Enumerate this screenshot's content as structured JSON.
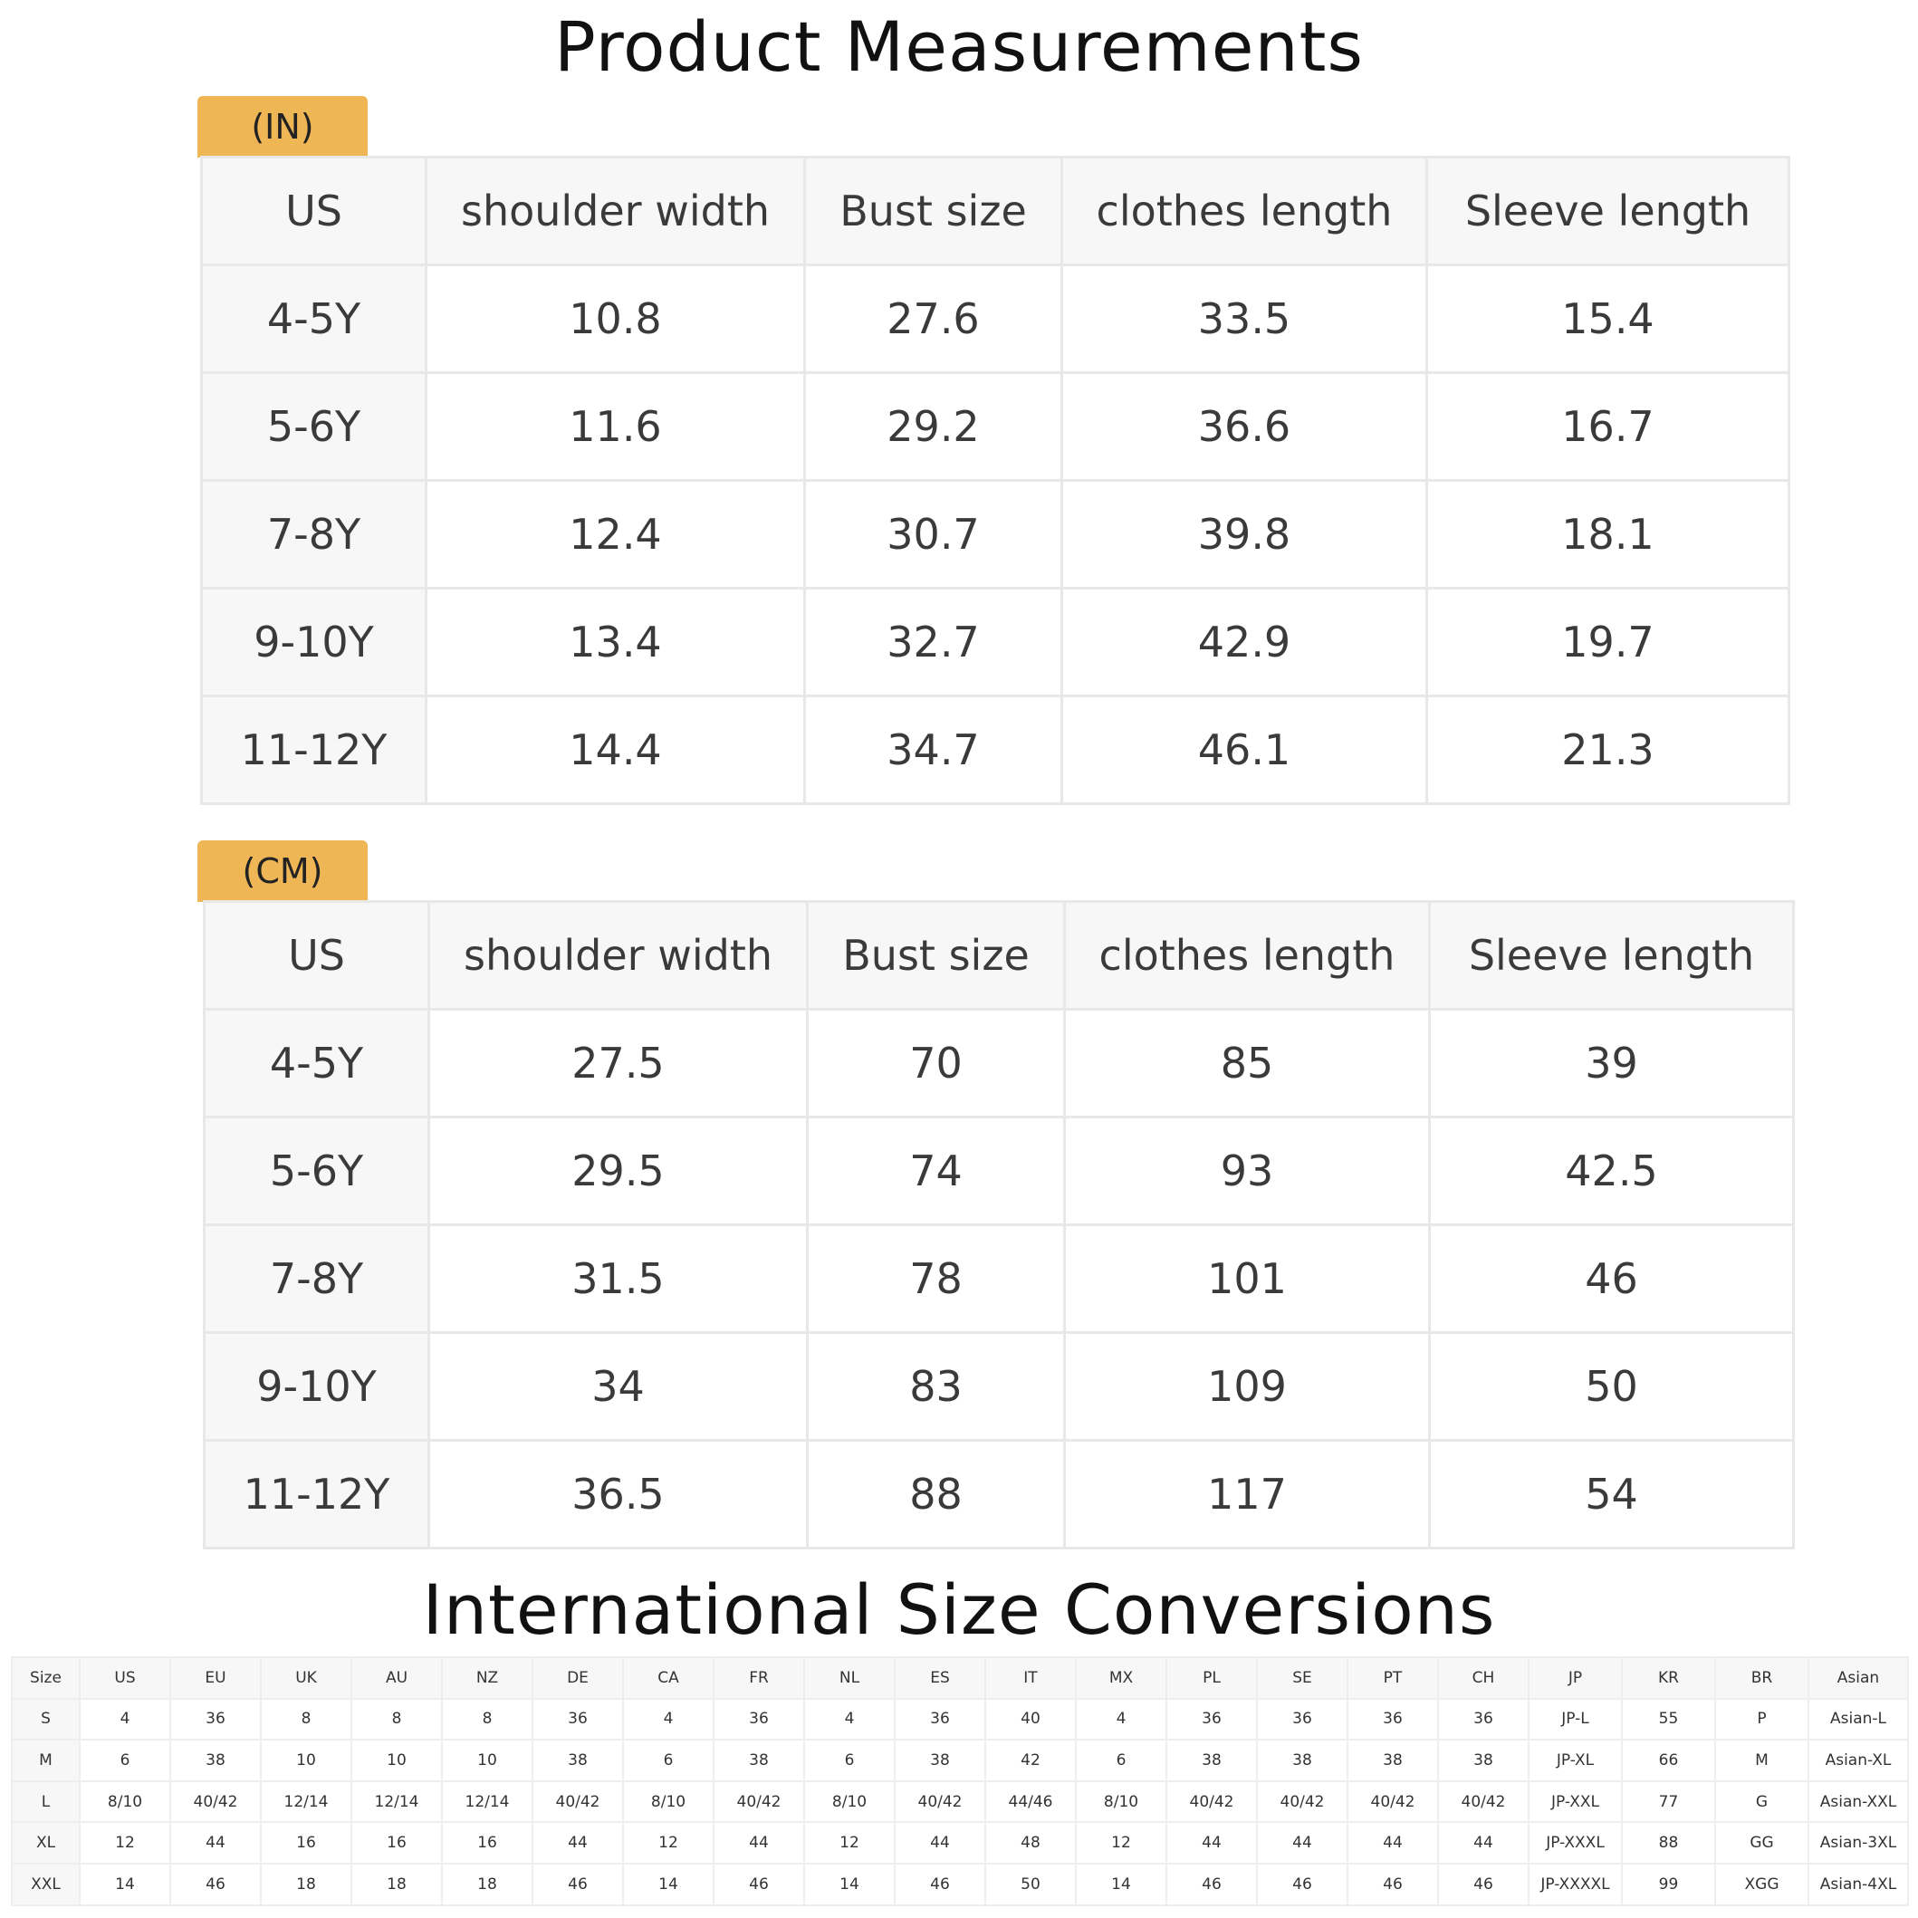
{
  "titles": {
    "product": "Product Measurements",
    "international": "International Size Conversions"
  },
  "colors": {
    "tag_background": "#efb655",
    "header_background": "#f7f7f7",
    "border": "#e8e8e8"
  },
  "inch_table": {
    "tag": "(IN)",
    "headers": [
      "US",
      "shoulder width",
      "Bust size",
      "clothes length",
      "Sleeve length"
    ],
    "rows": [
      [
        "4-5Y",
        "10.8",
        "27.6",
        "33.5",
        "15.4"
      ],
      [
        "5-6Y",
        "11.6",
        "29.2",
        "36.6",
        "16.7"
      ],
      [
        "7-8Y",
        "12.4",
        "30.7",
        "39.8",
        "18.1"
      ],
      [
        "9-10Y",
        "13.4",
        "32.7",
        "42.9",
        "19.7"
      ],
      [
        "11-12Y",
        "14.4",
        "34.7",
        "46.1",
        "21.3"
      ]
    ]
  },
  "cm_table": {
    "tag": "(CM)",
    "headers": [
      "US",
      "shoulder width",
      "Bust size",
      "clothes length",
      "Sleeve length"
    ],
    "rows": [
      [
        "4-5Y",
        "27.5",
        "70",
        "85",
        "39"
      ],
      [
        "5-6Y",
        "29.5",
        "74",
        "93",
        "42.5"
      ],
      [
        "7-8Y",
        "31.5",
        "78",
        "101",
        "46"
      ],
      [
        "9-10Y",
        "34",
        "83",
        "109",
        "50"
      ],
      [
        "11-12Y",
        "36.5",
        "88",
        "117",
        "54"
      ]
    ]
  },
  "intl_table": {
    "headers": [
      "Size",
      "US",
      "EU",
      "UK",
      "AU",
      "NZ",
      "DE",
      "CA",
      "FR",
      "NL",
      "ES",
      "IT",
      "MX",
      "PL",
      "SE",
      "PT",
      "CH",
      "JP",
      "KR",
      "BR",
      "Asian"
    ],
    "rows": [
      [
        "S",
        "4",
        "36",
        "8",
        "8",
        "8",
        "36",
        "4",
        "36",
        "4",
        "36",
        "40",
        "4",
        "36",
        "36",
        "36",
        "36",
        "JP-L",
        "55",
        "P",
        "Asian-L"
      ],
      [
        "M",
        "6",
        "38",
        "10",
        "10",
        "10",
        "38",
        "6",
        "38",
        "6",
        "38",
        "42",
        "6",
        "38",
        "38",
        "38",
        "38",
        "JP-XL",
        "66",
        "M",
        "Asian-XL"
      ],
      [
        "L",
        "8/10",
        "40/42",
        "12/14",
        "12/14",
        "12/14",
        "40/42",
        "8/10",
        "40/42",
        "8/10",
        "40/42",
        "44/46",
        "8/10",
        "40/42",
        "40/42",
        "40/42",
        "40/42",
        "JP-XXL",
        "77",
        "G",
        "Asian-XXL"
      ],
      [
        "XL",
        "12",
        "44",
        "16",
        "16",
        "16",
        "44",
        "12",
        "44",
        "12",
        "44",
        "48",
        "12",
        "44",
        "44",
        "44",
        "44",
        "JP-XXXL",
        "88",
        "GG",
        "Asian-3XL"
      ],
      [
        "XXL",
        "14",
        "46",
        "18",
        "18",
        "18",
        "46",
        "14",
        "46",
        "14",
        "46",
        "50",
        "14",
        "46",
        "46",
        "46",
        "46",
        "JP-XXXXL",
        "99",
        "XGG",
        "Asian-4XL"
      ]
    ]
  }
}
